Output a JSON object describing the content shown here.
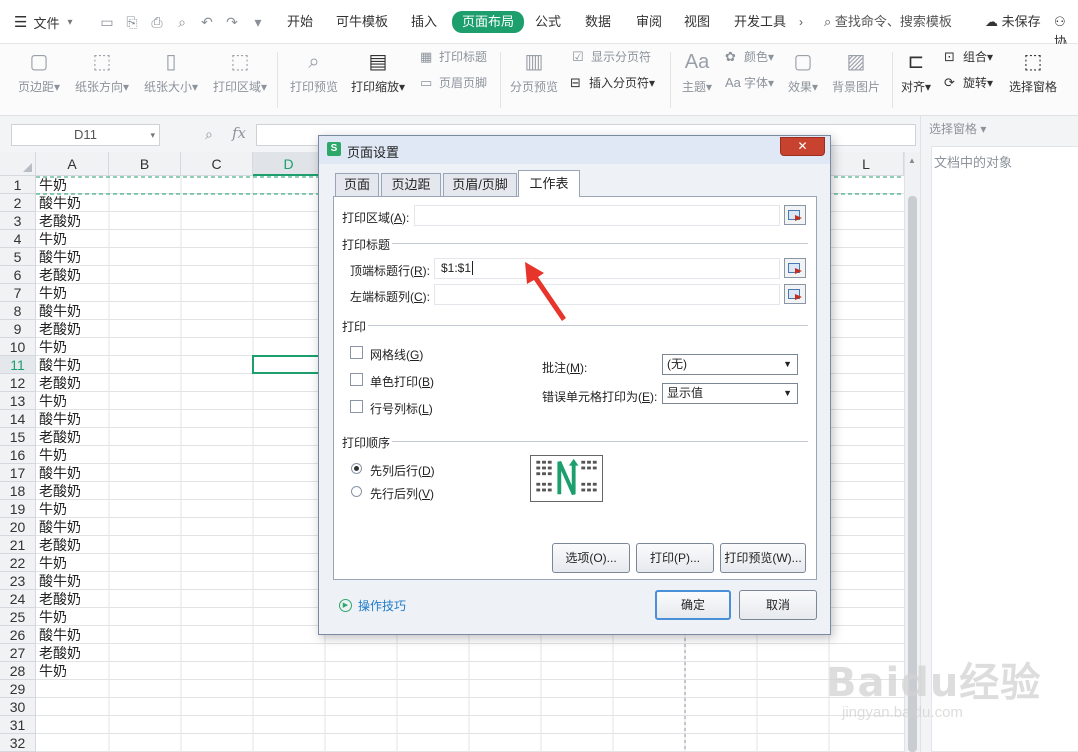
{
  "menubar": {
    "file_label": "文件",
    "tabs": [
      "开始",
      "可牛模板",
      "插入",
      "页面布局",
      "公式",
      "数据",
      "审阅",
      "视图",
      "开发工具"
    ],
    "active_tab": "页面布局",
    "search_label": "查找命令、搜索模板",
    "unsaved_label": "未保存",
    "collab_label": "协"
  },
  "ribbon": {
    "margins": "页边距",
    "orientation": "纸张方向",
    "paper_size": "纸张大小",
    "print_area": "打印区域",
    "print_preview": "打印预览",
    "print_scale": "打印缩放",
    "print_titles": "打印标题",
    "header_footer": "页眉页脚",
    "page_break_preview": "分页预览",
    "show_page_breaks": "显示分页符",
    "insert_page_break": "插入分页符",
    "theme": "主题",
    "colors": "颜色",
    "fonts": "字体",
    "effects": "效果",
    "background": "背景图片",
    "align": "对齐",
    "group": "组合",
    "rotate": "旋转",
    "selection_pane": "选择窗格"
  },
  "formula": {
    "name_box": "D11",
    "fx": "fx"
  },
  "sheet": {
    "columns": [
      "A",
      "B",
      "C",
      "D",
      "L"
    ],
    "selected_column": "D",
    "rows": [
      "1",
      "2",
      "3",
      "4",
      "5",
      "6",
      "7",
      "8",
      "9",
      "10",
      "11",
      "12",
      "13",
      "14",
      "15",
      "16",
      "17",
      "18",
      "19",
      "20",
      "21",
      "22",
      "23",
      "24",
      "25",
      "26",
      "27",
      "28",
      "29",
      "30",
      "31",
      "32"
    ],
    "selected_row": "11",
    "col_a": [
      "牛奶",
      "酸牛奶",
      "老酸奶",
      "牛奶",
      "酸牛奶",
      "老酸奶",
      "牛奶",
      "酸牛奶",
      "老酸奶",
      "牛奶",
      "酸牛奶",
      "老酸奶",
      "牛奶",
      "酸牛奶",
      "老酸奶",
      "牛奶",
      "酸牛奶",
      "老酸奶",
      "牛奶",
      "酸牛奶",
      "老酸奶",
      "牛奶",
      "酸牛奶",
      "老酸奶",
      "牛奶",
      "酸牛奶",
      "老酸奶",
      "牛奶"
    ]
  },
  "right_pane": {
    "title": "选择窗格",
    "header": "文档中的对象"
  },
  "dialog": {
    "title": "页面设置",
    "close": "✕",
    "tabs": [
      "页面",
      "页边距",
      "页眉/页脚",
      "工作表"
    ],
    "active_tab": "工作表",
    "print_area_label": "打印区域(",
    "print_area_key": "A",
    "print_area_value": "",
    "print_titles_group": "打印标题",
    "top_rows_label": "顶端标题行(",
    "top_rows_key": "R",
    "top_rows_value": "$1:$1",
    "left_cols_label": "左端标题列(",
    "left_cols_key": "C",
    "left_cols_value": "",
    "print_group": "打印",
    "gridlines_label": "网格线(",
    "gridlines_key": "G",
    "mono_label": "单色打印(",
    "mono_key": "B",
    "rowcol_label": "行号列标(",
    "rowcol_key": "L",
    "comments_label": "批注(",
    "comments_key": "M",
    "comments_value": "(无)",
    "errors_label": "错误单元格打印为(",
    "errors_key": "E",
    "errors_value": "显示值",
    "order_group": "打印顺序",
    "down_then_over_label": "先列后行(",
    "down_then_over_key": "D",
    "over_then_down_label": "先行后列(",
    "over_then_down_key": "V",
    "options_button": "选项(O)...",
    "print_button": "打印(P)...",
    "preview_button": "打印预览(W)...",
    "tips_label": "操作技巧",
    "ok_button": "确定",
    "cancel_button": "取消"
  },
  "watermark": {
    "brand": "Baidu经验",
    "url": "jingyan.baidu.com"
  },
  "colors": {
    "accent": "#1c9f6d",
    "arrow": "#e8352b",
    "close": "#c7432f"
  }
}
